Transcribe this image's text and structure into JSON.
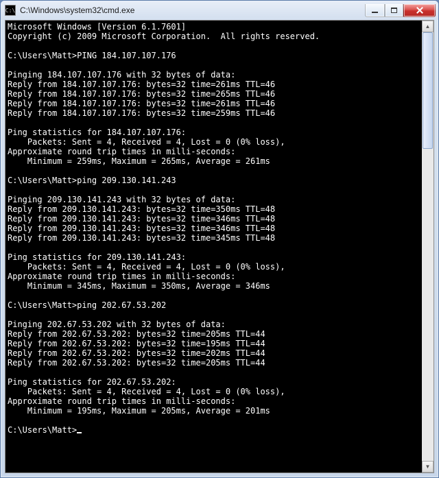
{
  "window": {
    "title": "C:\\Windows\\system32\\cmd.exe",
    "icon_glyph": "C:\\"
  },
  "header": {
    "line1": "Microsoft Windows [Version 6.1.7601]",
    "line2": "Copyright (c) 2009 Microsoft Corporation.  All rights reserved."
  },
  "prompt_base": "C:\\Users\\Matt>",
  "sessions": [
    {
      "command": "PING 184.107.107.176",
      "target": "184.107.107.176",
      "bytes": 32,
      "replies": [
        {
          "bytes": 32,
          "time_ms": 261,
          "ttl": 46
        },
        {
          "bytes": 32,
          "time_ms": 265,
          "ttl": 46
        },
        {
          "bytes": 32,
          "time_ms": 261,
          "ttl": 46
        },
        {
          "bytes": 32,
          "time_ms": 259,
          "ttl": 46
        }
      ],
      "stats": {
        "sent": 4,
        "received": 4,
        "lost": 0,
        "loss_pct": 0,
        "min_ms": 259,
        "max_ms": 265,
        "avg_ms": 261
      }
    },
    {
      "command": "ping 209.130.141.243",
      "target": "209.130.141.243",
      "bytes": 32,
      "replies": [
        {
          "bytes": 32,
          "time_ms": 350,
          "ttl": 48
        },
        {
          "bytes": 32,
          "time_ms": 346,
          "ttl": 48
        },
        {
          "bytes": 32,
          "time_ms": 346,
          "ttl": 48
        },
        {
          "bytes": 32,
          "time_ms": 345,
          "ttl": 48
        }
      ],
      "stats": {
        "sent": 4,
        "received": 4,
        "lost": 0,
        "loss_pct": 0,
        "min_ms": 345,
        "max_ms": 350,
        "avg_ms": 346
      }
    },
    {
      "command": "ping 202.67.53.202",
      "target": "202.67.53.202",
      "bytes": 32,
      "replies": [
        {
          "bytes": 32,
          "time_ms": 205,
          "ttl": 44
        },
        {
          "bytes": 32,
          "time_ms": 195,
          "ttl": 44
        },
        {
          "bytes": 32,
          "time_ms": 202,
          "ttl": 44
        },
        {
          "bytes": 32,
          "time_ms": 205,
          "ttl": 44
        }
      ],
      "stats": {
        "sent": 4,
        "received": 4,
        "lost": 0,
        "loss_pct": 0,
        "min_ms": 195,
        "max_ms": 205,
        "avg_ms": 201
      }
    }
  ]
}
